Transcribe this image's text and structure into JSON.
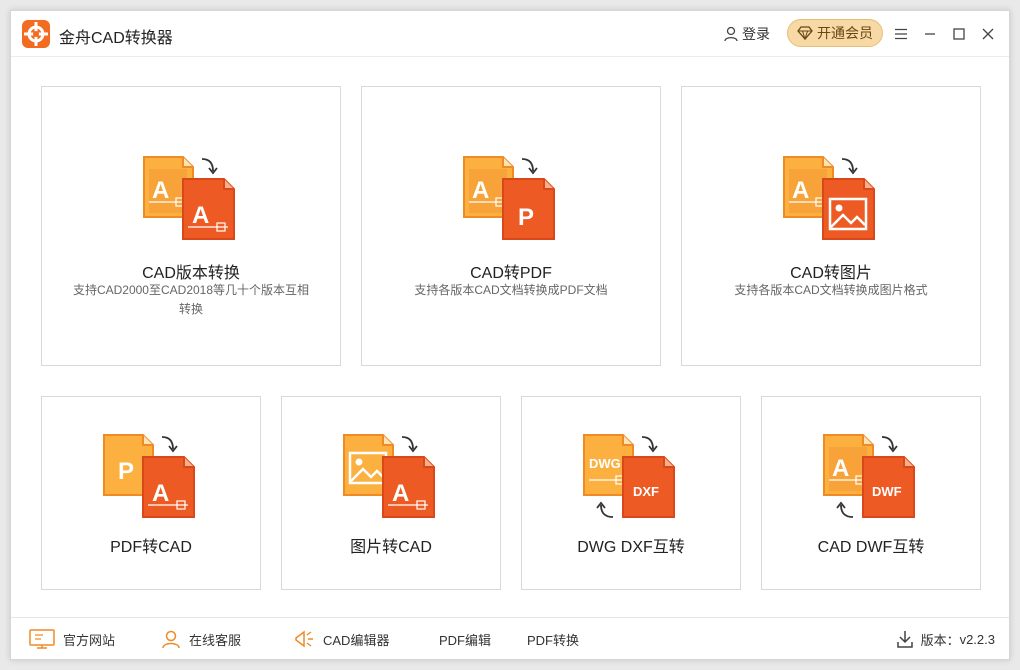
{
  "window": {
    "title": "金舟CAD转换器",
    "login_label": "登录",
    "vip_label": "开通会员"
  },
  "cards": [
    {
      "title": "CAD版本转换",
      "desc": "支持CAD2000至CAD2018等几十个版本互相转换"
    },
    {
      "title": "CAD转PDF",
      "desc": "支持各版本CAD文档转换成PDF文档"
    },
    {
      "title": "CAD转图片",
      "desc": "支持各版本CAD文档转换成图片格式"
    },
    {
      "title": "PDF转CAD",
      "desc": ""
    },
    {
      "title": "图片转CAD",
      "desc": ""
    },
    {
      "title": "DWG DXF互转",
      "desc": ""
    },
    {
      "title": "CAD DWF互转",
      "desc": ""
    }
  ],
  "icons": {
    "letter_a": "A",
    "letter_p": "P",
    "dwg": "DWG",
    "dxf": "DXF",
    "dwf": "DWF"
  },
  "footer": {
    "website": "官方网站",
    "support": "在线客服",
    "cad_editor": "CAD编辑器",
    "pdf_editor": "PDF编辑",
    "pdf_convert": "PDF转换",
    "version_label": "版本：",
    "version": "v2.2.3"
  },
  "colors": {
    "accent": "#f26b21",
    "doc_back": "#f8a23a",
    "doc_front": "#ee5a24",
    "vip_bg": "#f7d9a6"
  }
}
